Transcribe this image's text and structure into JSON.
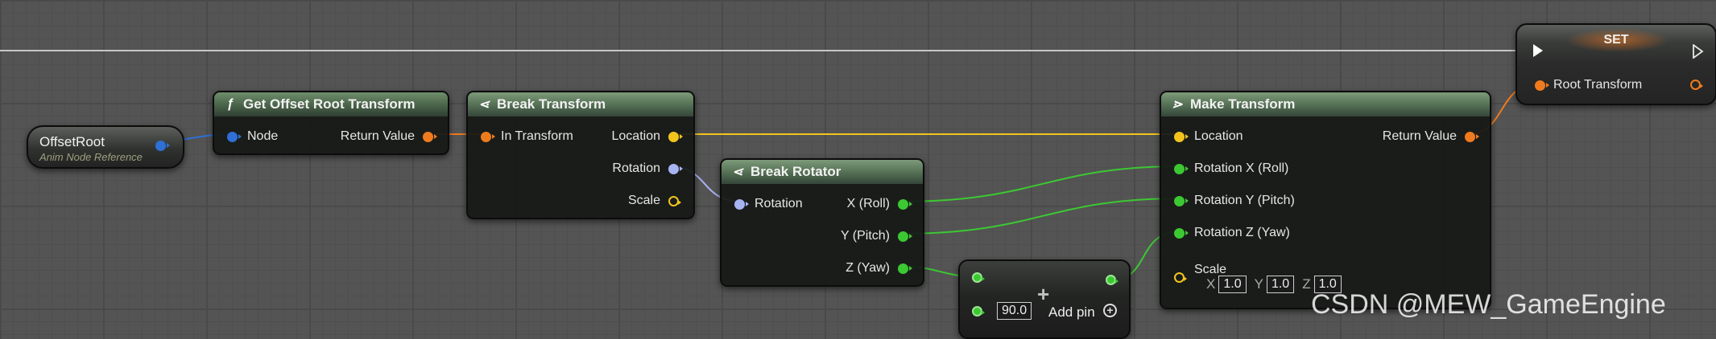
{
  "colors": {
    "object": "#2f6fd6",
    "transform": "#f07b1e",
    "vector": "#f3c41e",
    "rotator": "#a7b4f2",
    "float": "#3cc832",
    "header": "#5a7659"
  },
  "nodes": {
    "offset_root": {
      "title": "OffsetRoot",
      "subtitle": "Anim Node Reference"
    },
    "get_offset": {
      "icon": "f-icon",
      "title": "Get Offset Root Transform",
      "node_pin": "Node",
      "return_pin": "Return Value"
    },
    "break_transform": {
      "title": "Break Transform",
      "in_pin": "In Transform",
      "location": "Location",
      "rotation": "Rotation",
      "scale": "Scale"
    },
    "break_rotator": {
      "title": "Break Rotator",
      "rotation": "Rotation",
      "x": "X (Roll)",
      "y": "Y (Pitch)",
      "z": "Z (Yaw)"
    },
    "add": {
      "value": "90.0",
      "add_pin": "Add pin"
    },
    "make_transform": {
      "title": "Make Transform",
      "location": "Location",
      "return_pin": "Return Value",
      "rot_x": "Rotation X (Roll)",
      "rot_y": "Rotation Y (Pitch)",
      "rot_z": "Rotation Z (Yaw)",
      "scale": "Scale",
      "scale_x_label": "X",
      "scale_x": "1.0",
      "scale_y_label": "Y",
      "scale_y": "1.0",
      "scale_z_label": "Z",
      "scale_z": "1.0"
    },
    "set": {
      "title": "SET",
      "root_pin": "Root Transform"
    }
  },
  "watermark": "CSDN @MEW_GameEngine"
}
